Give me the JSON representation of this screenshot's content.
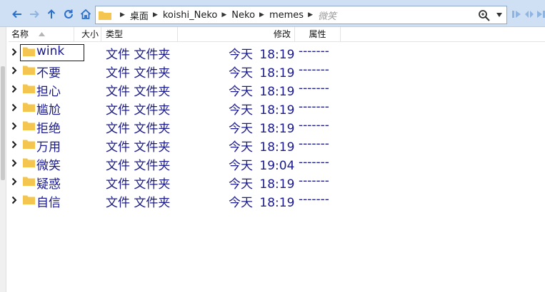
{
  "address": {
    "crumbs": [
      "桌面",
      "koishi_Neko",
      "Neko",
      "memes"
    ],
    "current": "微笑"
  },
  "columns": {
    "name": "名称",
    "size": "大小",
    "type": "类型",
    "modified": "修改",
    "attributes": "属性"
  },
  "colors": {
    "toolbar_bg": "#cfe0f5",
    "text_blue": "#1a1a8c",
    "folder_yellow": "#f4c54f"
  },
  "rows": [
    {
      "name": "wink",
      "type": "文件 文件夹",
      "modified": "今天 18:19",
      "attributes": "-------"
    },
    {
      "name": "不要",
      "type": "文件 文件夹",
      "modified": "今天 18:19",
      "attributes": "-------"
    },
    {
      "name": "担心",
      "type": "文件 文件夹",
      "modified": "今天 18:19",
      "attributes": "-------"
    },
    {
      "name": "尴尬",
      "type": "文件 文件夹",
      "modified": "今天 18:19",
      "attributes": "-------"
    },
    {
      "name": "拒绝",
      "type": "文件 文件夹",
      "modified": "今天 18:19",
      "attributes": "-------"
    },
    {
      "name": "万用",
      "type": "文件 文件夹",
      "modified": "今天 18:19",
      "attributes": "-------"
    },
    {
      "name": "微笑",
      "type": "文件 文件夹",
      "modified": "今天 19:04",
      "attributes": "-------"
    },
    {
      "name": "疑惑",
      "type": "文件 文件夹",
      "modified": "今天 18:19",
      "attributes": "-------"
    },
    {
      "name": "自信",
      "type": "文件 文件夹",
      "modified": "今天 18:19",
      "attributes": "-------"
    }
  ]
}
